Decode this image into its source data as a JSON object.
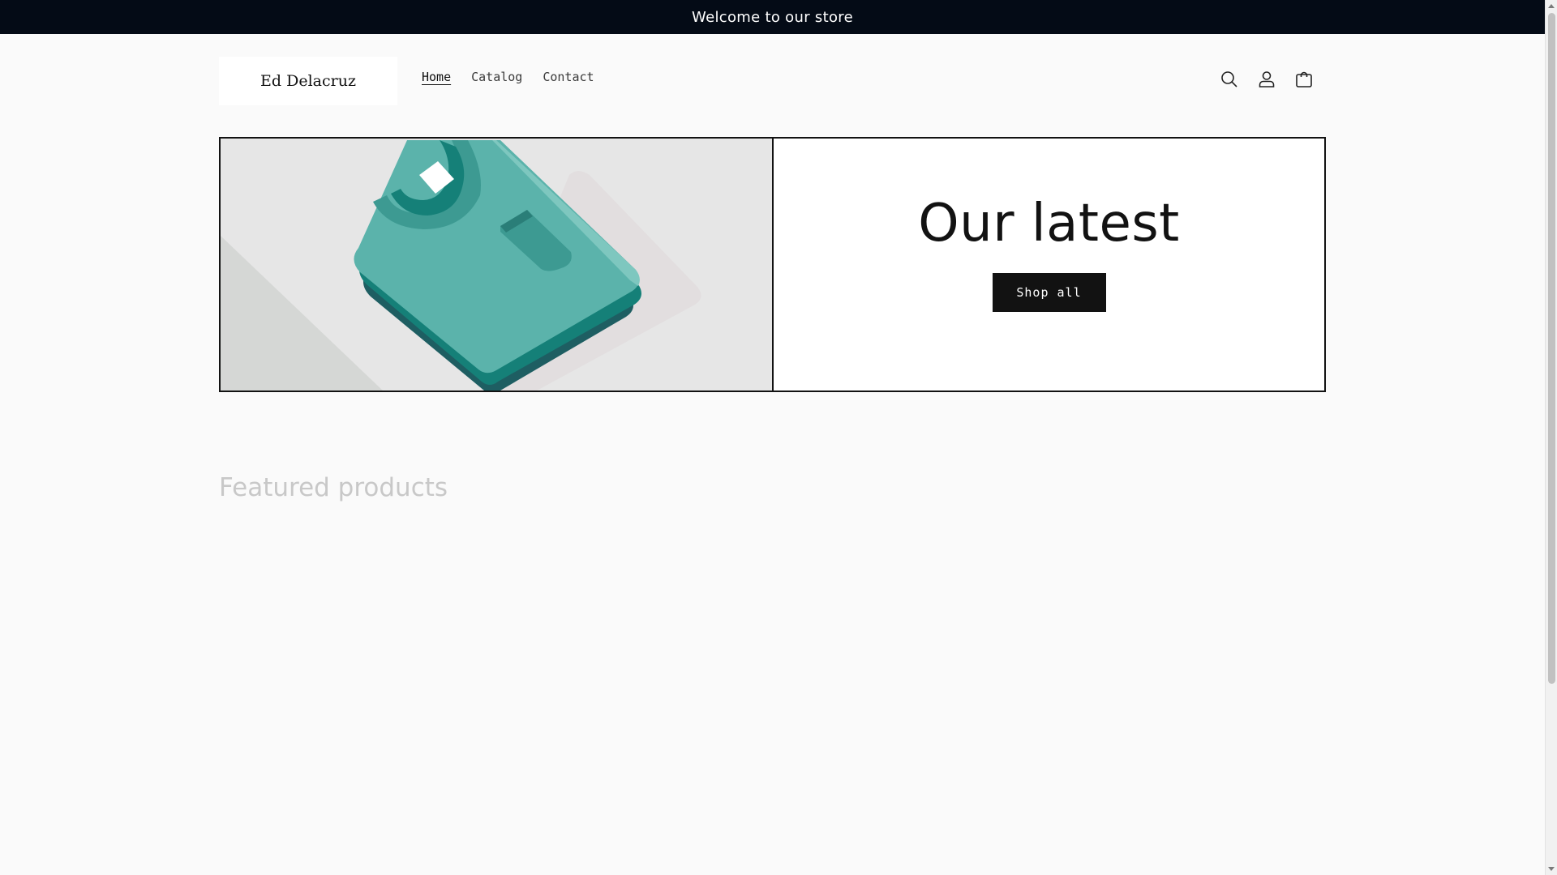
{
  "announcement": {
    "text": "Welcome to our store"
  },
  "header": {
    "logo_text": "Ed Delacruz",
    "nav": [
      {
        "label": "Home",
        "active": true
      },
      {
        "label": "Catalog",
        "active": false
      },
      {
        "label": "Contact",
        "active": false
      }
    ],
    "icons": [
      "search-icon",
      "account-icon",
      "cart-icon"
    ]
  },
  "hero": {
    "title": "Our latest",
    "button_label": "Shop all",
    "image_icon": "folded-tshirt-illustration"
  },
  "featured": {
    "title": "Featured products"
  },
  "colors": {
    "announcement_bg": "#040b16",
    "button_bg": "#121212",
    "tshirt_light": "#5bb3ab",
    "tshirt_mid": "#158078",
    "tshirt_dark": "#1e5e62",
    "featured_text": "#c8c8c8"
  }
}
